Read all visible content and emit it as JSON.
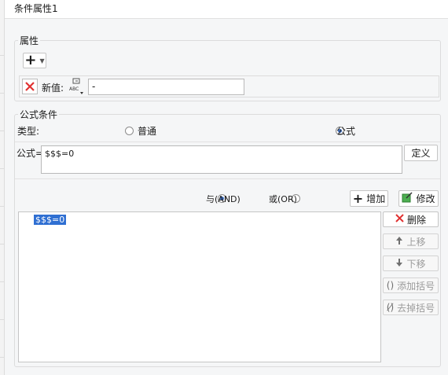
{
  "window": {
    "title": "条件属性1"
  },
  "property_group": {
    "legend": "属性",
    "add_icon": "plus-icon",
    "row": {
      "label": "新值:",
      "value": "-",
      "type_icon": "abc-type-icon"
    }
  },
  "formula_group": {
    "legend": "公式条件",
    "type_label": "类型:",
    "radio_normal": "普通",
    "radio_formula": "公式",
    "selected": "formula",
    "formula_label": "公式=",
    "formula_value": "$$$=0",
    "define_button": "定义",
    "and_label": "与(AND)",
    "or_label": "或(OR)",
    "logic_selected": "and",
    "add_button": "增加",
    "edit_button": "修改",
    "conditions": [
      "$$$=0"
    ],
    "side_buttons": {
      "delete": "删除",
      "up": "上移",
      "down": "下移",
      "add_bracket": "添加括号",
      "remove_bracket": "去掉括号"
    }
  },
  "colors": {
    "accent": "#3d6fc4",
    "delete_red": "#e03030",
    "selection": "#2f6fd2"
  }
}
